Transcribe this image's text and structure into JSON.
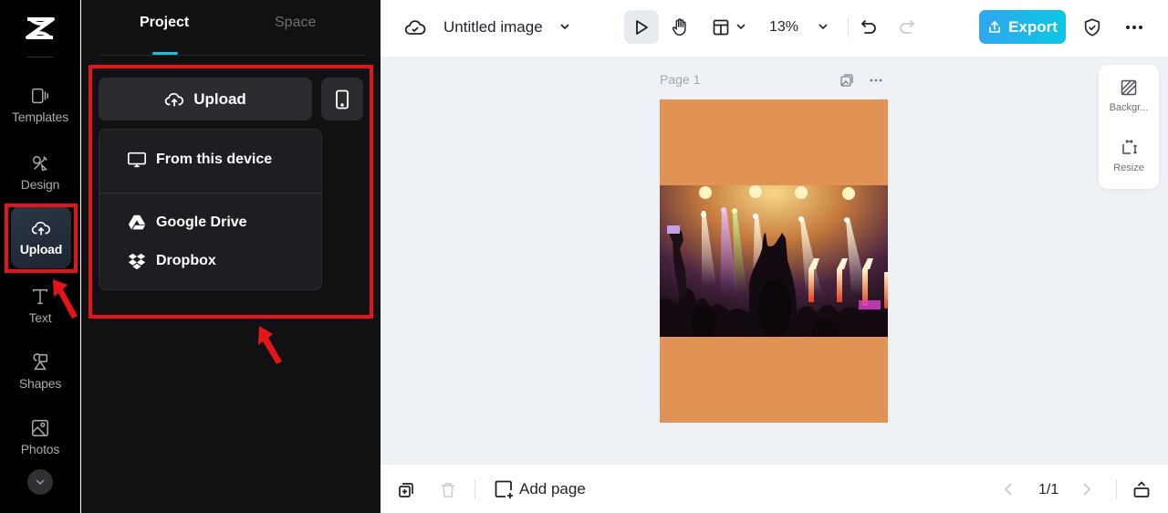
{
  "rail": {
    "logo": "capcut-logo",
    "items": [
      {
        "label": "Templates",
        "icon": "templates-icon"
      },
      {
        "label": "Design",
        "icon": "design-icon"
      },
      {
        "label": "Upload",
        "icon": "upload-cloud-icon",
        "active": true
      },
      {
        "label": "Text",
        "icon": "text-icon"
      },
      {
        "label": "Shapes",
        "icon": "shapes-icon"
      },
      {
        "label": "Photos",
        "icon": "photos-icon"
      }
    ],
    "more_icon": "chevron-down-icon"
  },
  "panel": {
    "tabs": [
      {
        "label": "Project",
        "active": true
      },
      {
        "label": "Space",
        "active": false
      }
    ],
    "upload_button": "Upload",
    "phone_button_icon": "mobile-phone-icon",
    "upload_menu": {
      "items": [
        {
          "label": "From this device",
          "icon": "monitor-icon"
        },
        {
          "label": "Google Drive",
          "icon": "google-drive-icon"
        },
        {
          "label": "Dropbox",
          "icon": "dropbox-icon"
        }
      ]
    }
  },
  "topbar": {
    "save_status_icon": "cloud-check-icon",
    "title": "Untitled image",
    "zoom": "13%",
    "export_label": "Export"
  },
  "canvas": {
    "page_label": "Page 1",
    "page_background": "#e09355",
    "side_panel": [
      {
        "label": "Backgr...",
        "icon": "background-icon"
      },
      {
        "label": "Resize",
        "icon": "resize-icon"
      }
    ]
  },
  "bottombar": {
    "add_page_label": "Add page",
    "page_count": "1/1"
  },
  "colors": {
    "accent": "#18c3df",
    "export_start": "#30a6f0",
    "export_end": "#0cc7e3",
    "annotation_red": "#e4141b"
  }
}
